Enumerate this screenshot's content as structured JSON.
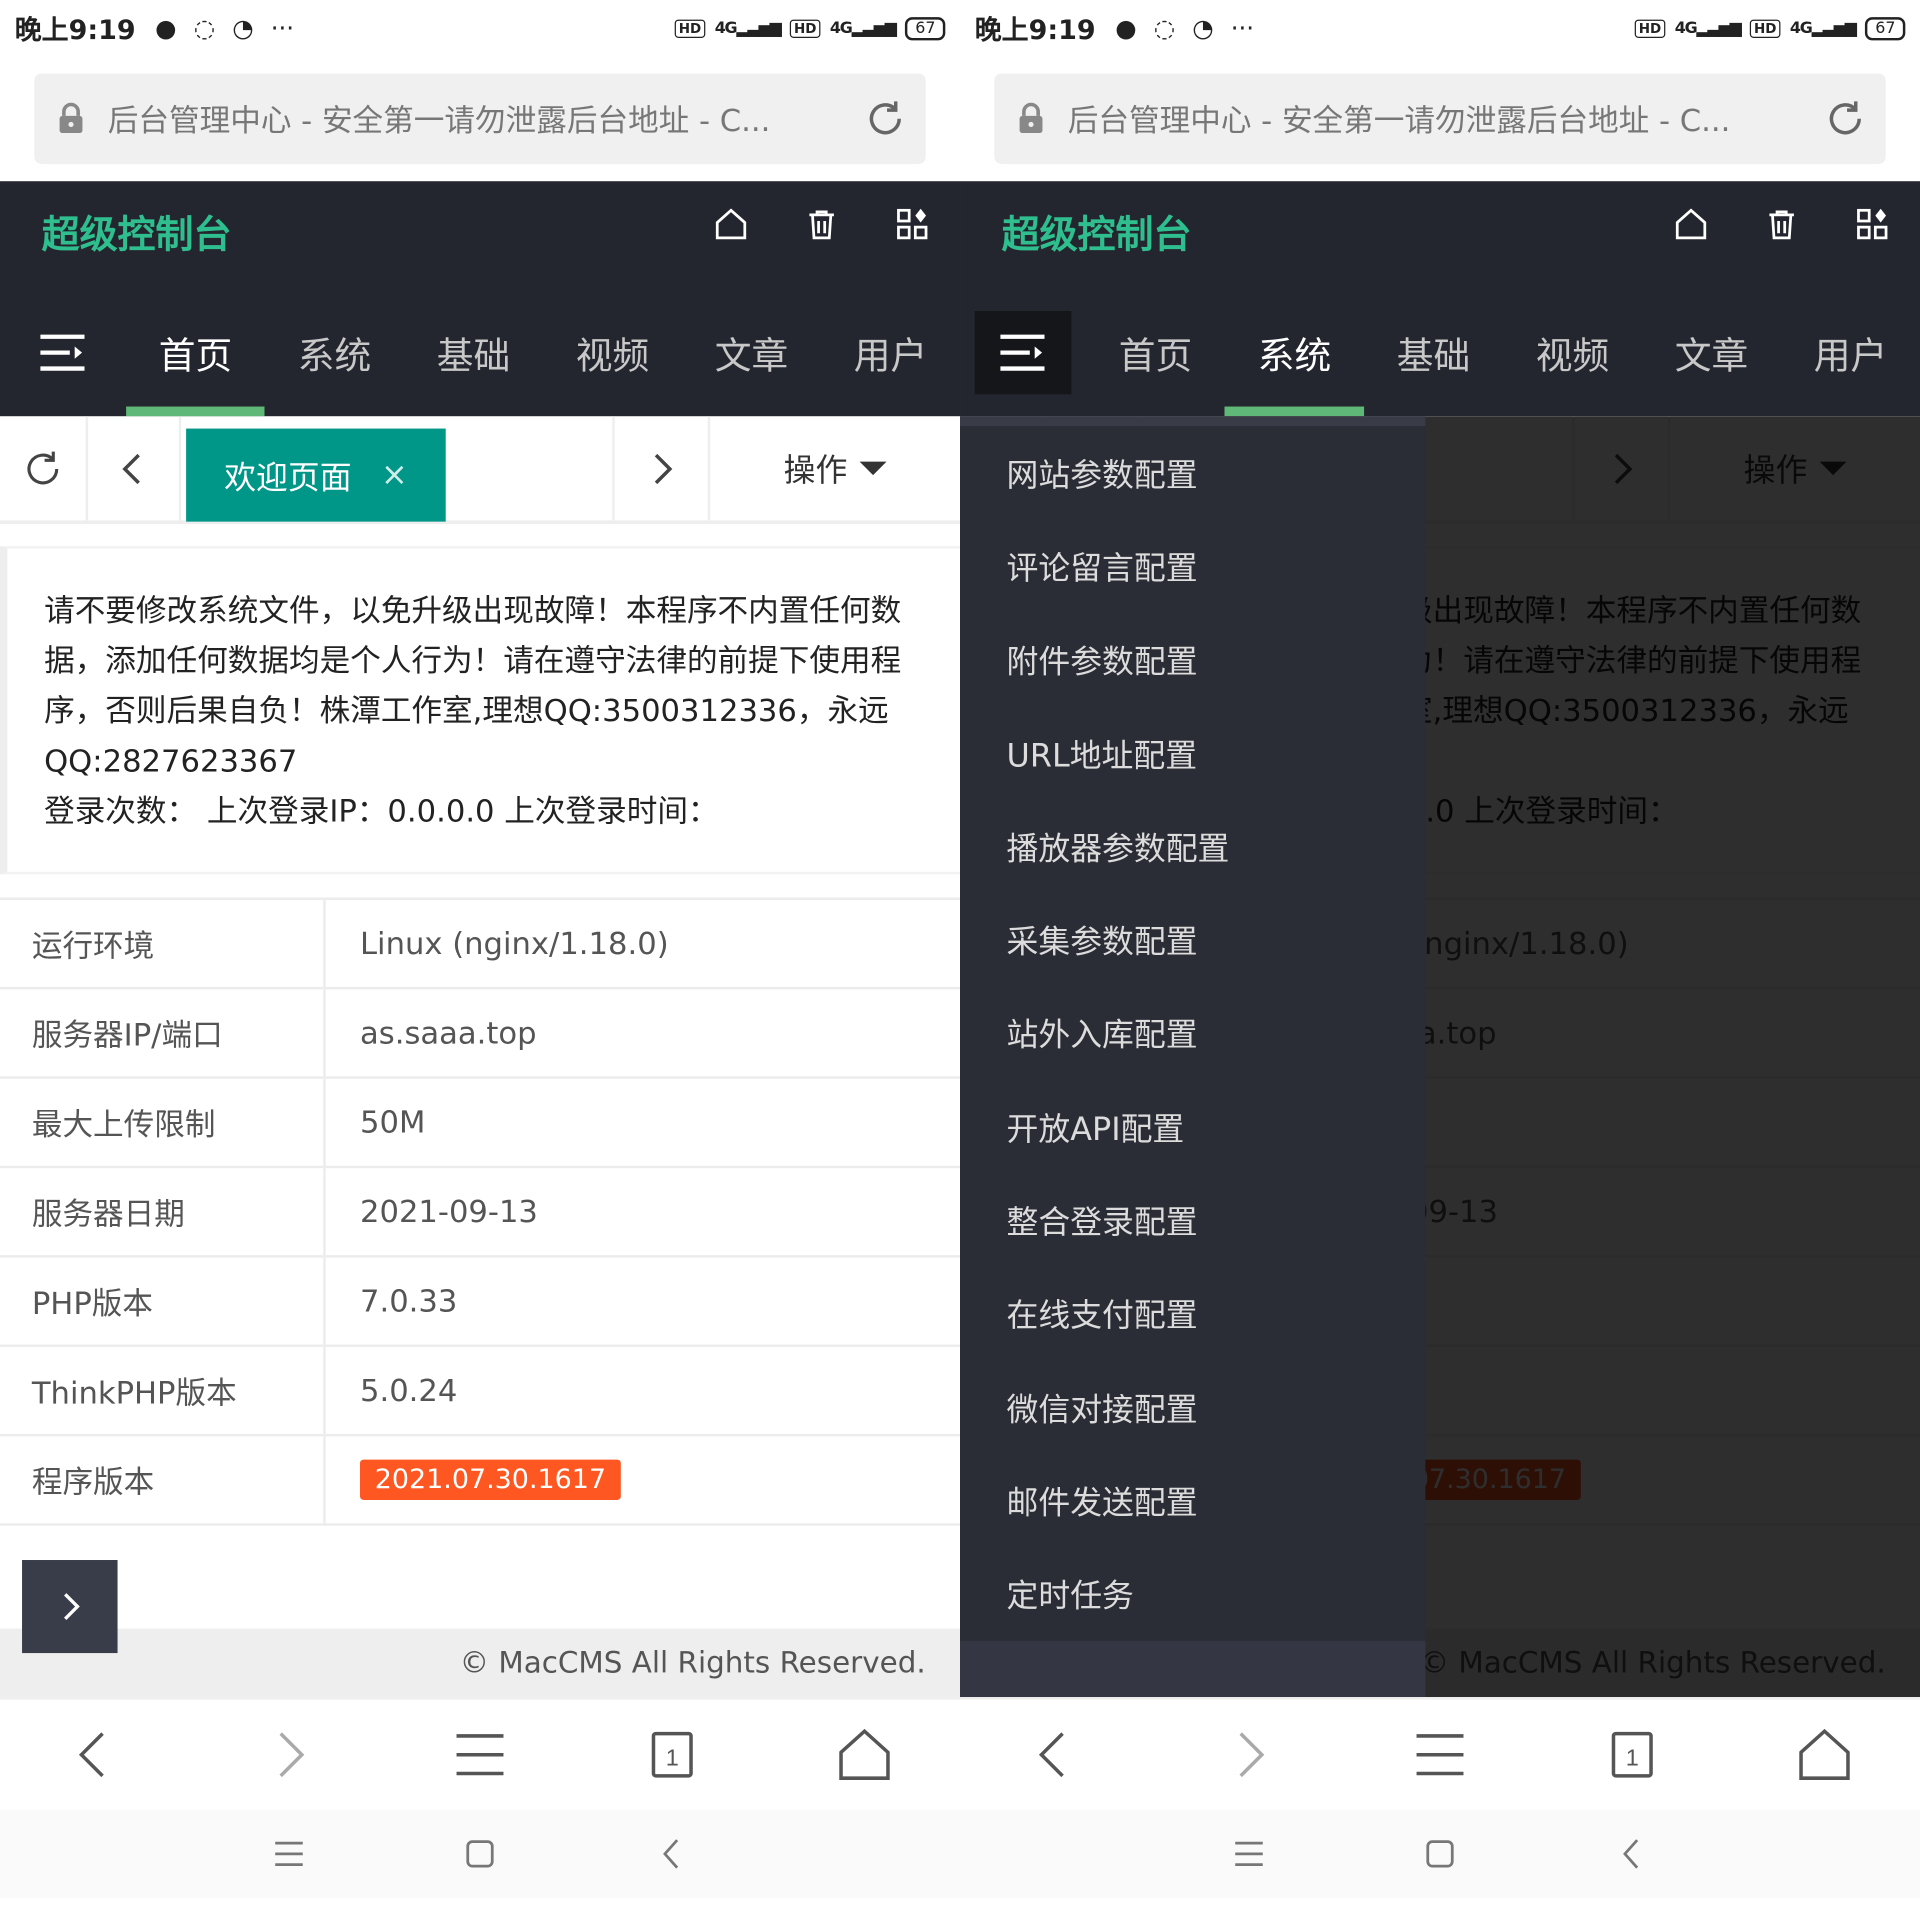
{
  "status_bar": {
    "time": "晚上9:19",
    "hd": "HD",
    "signal": "4G",
    "battery": "67"
  },
  "browser": {
    "url_title": "后台管理中心 - 安全第一请勿泄露后台地址 - C...",
    "tab_count": "1"
  },
  "admin": {
    "brand": "超级控制台",
    "nav": [
      "首页",
      "系统",
      "基础",
      "视频",
      "文章",
      "用户"
    ]
  },
  "tabs": {
    "active_tab": "欢迎页面",
    "close_symbol": "×",
    "operations": "操作"
  },
  "notice": {
    "line1": "请不要修改系统文件，以免升级出现故障！本程序不内置任何数据，添加任何数据均是个人行为！请在遵守法律的前提下使用程序，否则后果自负！株潭工作室,理想QQ:3500312336，永远QQ:2827623367",
    "line2": "登录次数：  上次登录IP：0.0.0.0  上次登录时间："
  },
  "info": [
    {
      "label": "运行环境",
      "value": "Linux (nginx/1.18.0)"
    },
    {
      "label": "服务器IP/端口",
      "value": "as.saaa.top"
    },
    {
      "label": "最大上传限制",
      "value": "50M"
    },
    {
      "label": "服务器日期",
      "value": "2021-09-13"
    },
    {
      "label": "PHP版本",
      "value": "7.0.33"
    },
    {
      "label": "ThinkPHP版本",
      "value": "5.0.24"
    },
    {
      "label": "程序版本",
      "value": "2021.07.30.1617"
    }
  ],
  "footer": "© MacCMS All Rights Reserved.",
  "system_menu": [
    "网站参数配置",
    "评论留言配置",
    "附件参数配置",
    "URL地址配置",
    "播放器参数配置",
    "采集参数配置",
    "站外入库配置",
    "开放API配置",
    "整合登录配置",
    "在线支付配置",
    "微信对接配置",
    "邮件发送配置",
    "定时任务"
  ],
  "colors": {
    "header_bg": "#23262e",
    "brand": "#2fbf8f",
    "nav_active_bar": "#5fb878",
    "tab_active": "#009688",
    "version_badge": "#ff5722",
    "sidemenu_bg": "#2b2d36"
  },
  "icons": {
    "header": [
      "home-icon",
      "trash-icon",
      "apps-icon"
    ],
    "menu": "menu-toggle-icon",
    "browser_toolbar": [
      "back-icon",
      "forward-icon",
      "menu-icon",
      "tabs-icon",
      "home-icon"
    ],
    "system_nav": [
      "recent-apps-icon",
      "home-square-icon",
      "back-triangle-icon"
    ]
  }
}
